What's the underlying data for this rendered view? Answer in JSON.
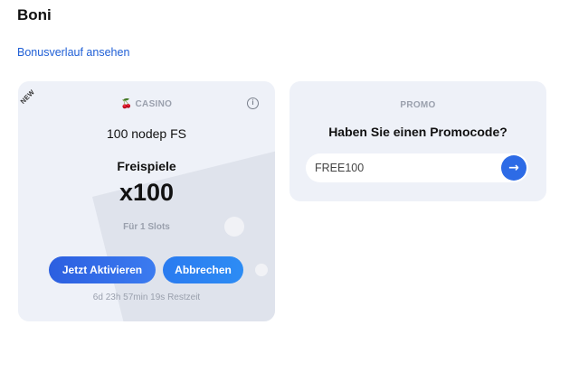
{
  "page": {
    "title": "Boni",
    "history_link": "Bonusverlauf ansehen"
  },
  "bonus_card": {
    "ribbon": "NEW",
    "category_icon": "cherry-icon",
    "category": "CASINO",
    "info_icon": "info-icon",
    "name": "100 nodep FS",
    "type": "Freispiele",
    "amount": "x100",
    "slots": "Für 1 Slots",
    "activate_label": "Jetzt Aktivieren",
    "cancel_label": "Abbrechen",
    "countdown": "6d 23h 57min 19s Restzeit"
  },
  "promo_card": {
    "label": "PROMO",
    "heading": "Haben Sie einen Promocode?",
    "input_value": "FREE100",
    "submit_icon": "arrow-right-icon"
  },
  "colors": {
    "link": "#1f5fd6",
    "button_primary": "#2c5fe0",
    "button_secondary": "#2a7bf0",
    "card_bg": "#eef1f8"
  }
}
